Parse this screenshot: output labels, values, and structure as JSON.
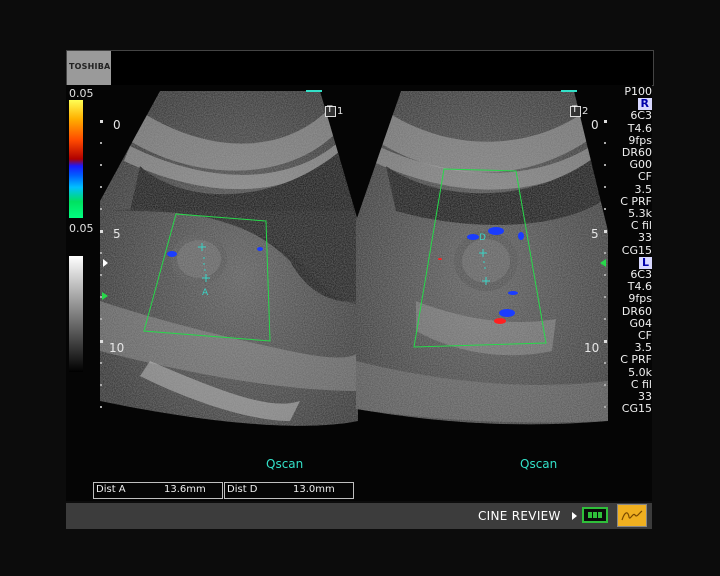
{
  "banner": {
    "logo_text": "TOSHIBA"
  },
  "color_scale": {
    "top_label": "0.05",
    "bottom_label": "0.05"
  },
  "panels": {
    "left": {
      "tag": "1",
      "qscan_label": "Qscan"
    },
    "right": {
      "tag": "2",
      "qscan_label": "Qscan"
    }
  },
  "depth_scale": {
    "labels": [
      "0",
      "5",
      "10"
    ]
  },
  "parameters": {
    "header": "P100",
    "probe_r": {
      "marker": "R",
      "lines": [
        "6C3",
        "T4.6",
        "9fps",
        "DR60",
        "G00",
        "CF",
        "3.5",
        "C PRF",
        "5.3k",
        "C fil",
        "33",
        "CG15"
      ]
    },
    "probe_l": {
      "marker": "L",
      "lines": [
        "6C3",
        "T4.6",
        "9fps",
        "DR60",
        "G04",
        "CF",
        "3.5",
        "C PRF",
        "5.0k",
        "C fil",
        "33",
        "CG15"
      ]
    }
  },
  "measurements": [
    {
      "label": "Dist A",
      "value": "13.6mm"
    },
    {
      "label": "Dist D",
      "value": "13.0mm"
    }
  ],
  "caliper_labels": {
    "left": "A",
    "right": "D"
  },
  "footer": {
    "cine_label": "CINE REVIEW"
  },
  "colors": {
    "roi_box": "#27d84a",
    "caliper": "#3ad6c8",
    "qscan": "#33e0c8",
    "doppler_blue": "#1a3cff",
    "doppler_red": "#ff2020",
    "cine_green": "#2fbf3a",
    "stamp_orange": "#f0b020"
  },
  "icons": {
    "tag_icon": "T-in-box",
    "play": "play-triangle-icon",
    "cine_button": "cine-loop-icon",
    "stamp": "signature-stamp-icon"
  }
}
